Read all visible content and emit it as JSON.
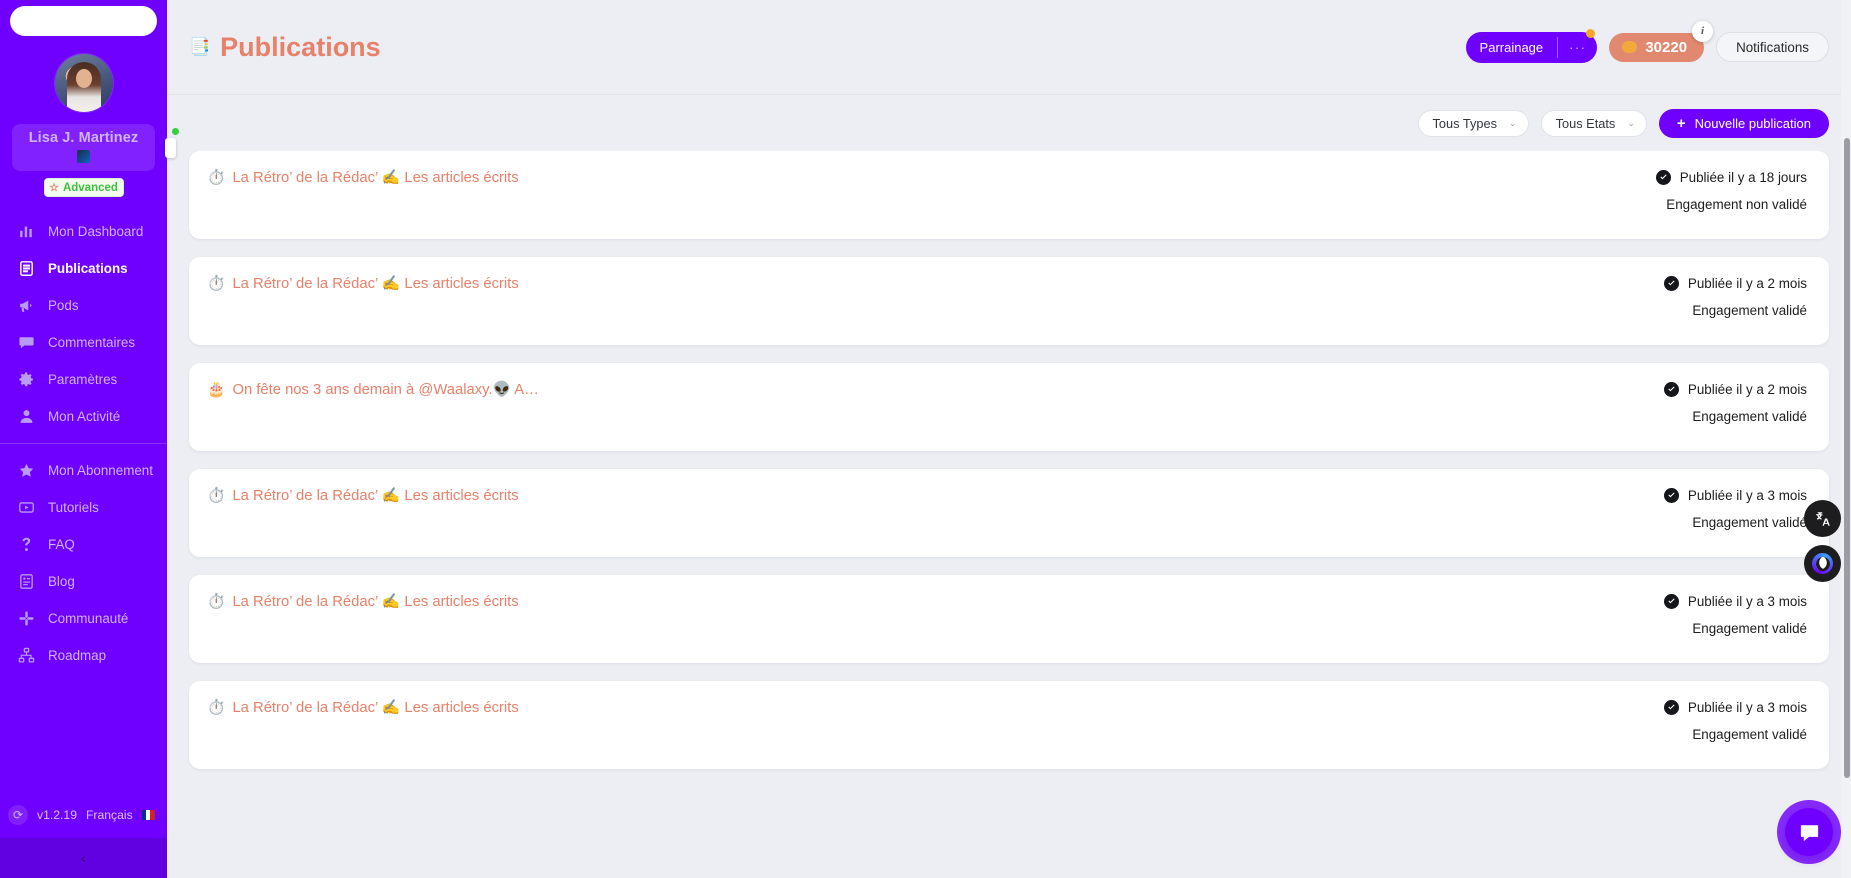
{
  "sidebar": {
    "search_placeholder": "",
    "profile": {
      "name": "Lisa J. Martinez",
      "plan_label": "Advanced",
      "plan_star": "☆"
    },
    "items": [
      {
        "label": "Mon Dashboard",
        "icon": "bar-chart-icon",
        "active": false
      },
      {
        "label": "Publications",
        "icon": "document-icon",
        "active": true
      },
      {
        "label": "Pods",
        "icon": "megaphone-icon",
        "active": false
      },
      {
        "label": "Commentaires",
        "icon": "comment-icon",
        "active": false
      },
      {
        "label": "Paramètres",
        "icon": "gear-icon",
        "active": false
      },
      {
        "label": "Mon Activité",
        "icon": "user-icon",
        "active": false
      }
    ],
    "items_secondary": [
      {
        "label": "Mon Abonnement",
        "icon": "star-icon",
        "active": false
      },
      {
        "label": "Tutoriels",
        "icon": "video-icon",
        "active": false
      },
      {
        "label": "FAQ",
        "icon": "question-icon",
        "active": false
      },
      {
        "label": "Blog",
        "icon": "article-icon",
        "active": false
      },
      {
        "label": "Communauté",
        "icon": "slack-icon",
        "active": false
      },
      {
        "label": "Roadmap",
        "icon": "sitemap-icon",
        "active": false
      }
    ],
    "footer": {
      "version": "v1.2.19",
      "language": "Français",
      "flag": "fr-flag-icon",
      "refresh_icon": "refresh-icon"
    },
    "collapse_icon": "‹"
  },
  "header": {
    "title": "Publications",
    "title_icon": "📑",
    "parrainage": {
      "label": "Parrainage",
      "menu_icon": "···",
      "badge": "notification-dot"
    },
    "credits": {
      "value": "30220",
      "coin_icon": "coin-icon",
      "info_icon": "i"
    },
    "notifications_label": "Notifications"
  },
  "filters": {
    "type_select": {
      "value": "Tous Types",
      "chevron": "⌄"
    },
    "state_select": {
      "value": "Tous Etats",
      "chevron": "⌄"
    },
    "new_publication": {
      "label": "Nouvelle publication",
      "plus": "+"
    }
  },
  "publications": [
    {
      "emoji": "⏱️",
      "title": "La Rétro’ de la Rédac’ ✍️ Les articles écrits",
      "status": "Publiée il y a 18 jours",
      "engagement": "Engagement non validé"
    },
    {
      "emoji": "⏱️",
      "title": "La Rétro’ de la Rédac’ ✍️ Les articles écrits",
      "status": "Publiée il y a 2 mois",
      "engagement": "Engagement validé"
    },
    {
      "emoji": "🎂",
      "title": "On fête nos 3 ans demain à @Waalaxy.👽 A…",
      "status": "Publiée il y a 2 mois",
      "engagement": "Engagement validé"
    },
    {
      "emoji": "⏱️",
      "title": "La Rétro’ de la Rédac’ ✍️ Les articles écrits",
      "status": "Publiée il y a 3 mois",
      "engagement": "Engagement validé"
    },
    {
      "emoji": "⏱️",
      "title": "La Rétro’ de la Rédac’ ✍️ Les articles écrits",
      "status": "Publiée il y a 3 mois",
      "engagement": "Engagement validé"
    },
    {
      "emoji": "⏱️",
      "title": "La Rétro’ de la Rédac’ ✍️ Les articles écrits",
      "status": "Publiée il y a 3 mois",
      "engagement": "Engagement validé"
    }
  ],
  "floating": {
    "translate_icon": "translate-icon",
    "face_icon": "face-icon",
    "chat_icon": "chat-bubble-icon"
  },
  "colors": {
    "sidebar_bg": "#6f00ff",
    "accent_orange": "#e8806a",
    "brand_purple": "#6f00ff",
    "credit_pill": "#e08970",
    "plan_green": "#3fbf3f"
  }
}
